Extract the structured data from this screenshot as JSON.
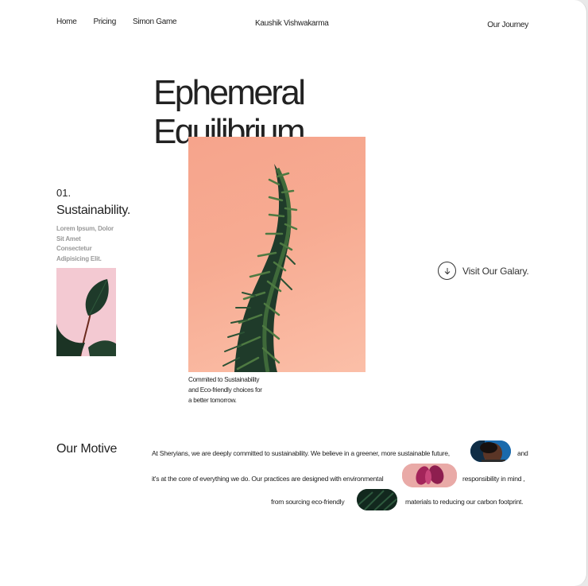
{
  "nav": {
    "links": [
      "Home",
      "Pricing",
      "Simon Game"
    ],
    "brand": "Kaushik Vishwakarma",
    "journey": "Our Journey"
  },
  "hero": {
    "title_line1": "Ephemeral",
    "title_line2": "Equilibrium.",
    "caption_line1": "Commited to Sustainability",
    "caption_line2": "and Eco-friendly choices for",
    "caption_line3": "a better tomorrow."
  },
  "side": {
    "number": "01.",
    "heading": "Sustainability.",
    "lorem_line1": "Lorem Ipsum, Dolor",
    "lorem_line2": "Sit Amet",
    "lorem_line3": "Consectetur",
    "lorem_line4": "Adipisicing Elit."
  },
  "gallery": {
    "label": "Visit Our Galary.",
    "icon": "arrow-down-circle-icon"
  },
  "motive": {
    "title": "Our Motive",
    "line1_a": "At Sheryians, we are deeply committed to sustainability. We believe in a greener, more sustainable future,",
    "line1_b": "and",
    "line2_a": "it's at the core of everything we do. Our practices are designed with environmental",
    "line2_b": "responsibility in mind ,",
    "line3_a": "from sourcing eco-friendly",
    "line3_b": "materials to reducing our carbon footprint."
  }
}
